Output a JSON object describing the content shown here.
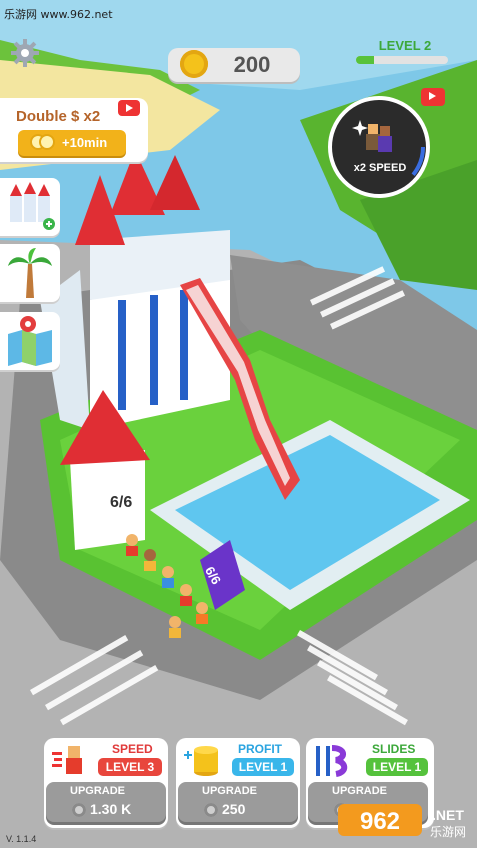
{
  "watermark_top": "乐游网 www.962.net",
  "coins": {
    "value": "200"
  },
  "level": {
    "label": "LEVEL 2",
    "progress": 0.2
  },
  "double_offer": {
    "title": "Double $ x2",
    "button_label": "+10min"
  },
  "speed_boost": {
    "label": "x2 SPEED"
  },
  "counters": {
    "castle": "6/6",
    "pool": "6/6"
  },
  "upgrades": [
    {
      "title": "SPEED",
      "level": "LEVEL 3",
      "button_label": "UPGRADE",
      "price": "1.30 K",
      "title_color": "#e03a3a",
      "level_color": "#e8463c"
    },
    {
      "title": "PROFIT",
      "level": "LEVEL 1",
      "button_label": "UPGRADE",
      "price": "250",
      "title_color": "#2aa4e0",
      "level_color": "#39b6ea"
    },
    {
      "title": "SLIDES",
      "level": "LEVEL 1",
      "button_label": "UPGRADE",
      "price": "",
      "title_color": "#3ca83a",
      "level_color": "#55c23c"
    }
  ],
  "version": "V. 1.1.4",
  "watermark_logo": {
    "text": "962",
    "suffix": ".NET",
    "sub": "乐游网"
  }
}
